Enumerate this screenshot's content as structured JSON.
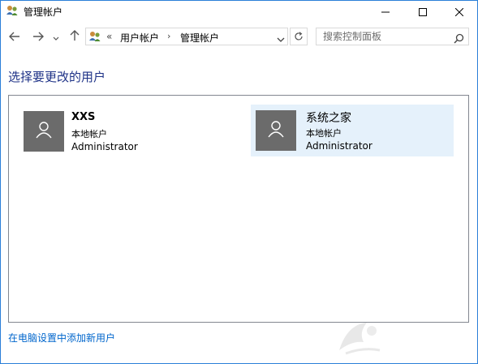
{
  "window": {
    "title": "管理帐户"
  },
  "navigation": {
    "address_prefix": "«",
    "breadcrumb": [
      "用户帐户",
      "管理帐户"
    ],
    "separator": "›",
    "search_placeholder": "搜索控制面板"
  },
  "main": {
    "heading": "选择要更改的用户",
    "users": [
      {
        "name": "XXS",
        "type": "本地帐户",
        "role": "Administrator",
        "selected": false
      },
      {
        "name": "系统之家",
        "type": "本地帐户",
        "role": "Administrator",
        "selected": true
      }
    ],
    "add_user_link": "在电脑设置中添加新用户"
  },
  "colors": {
    "heading": "#1e3287",
    "link": "#0066cc",
    "selection": "#e5f1fb",
    "avatar": "#6b6b6b"
  },
  "icons": [
    "user-accounts-icon",
    "minimize-icon",
    "maximize-icon",
    "close-icon",
    "back-arrow-icon",
    "forward-arrow-icon",
    "recent-locations-icon",
    "up-arrow-icon",
    "chevron-down-icon",
    "refresh-icon",
    "search-icon",
    "user-avatar-icon"
  ]
}
